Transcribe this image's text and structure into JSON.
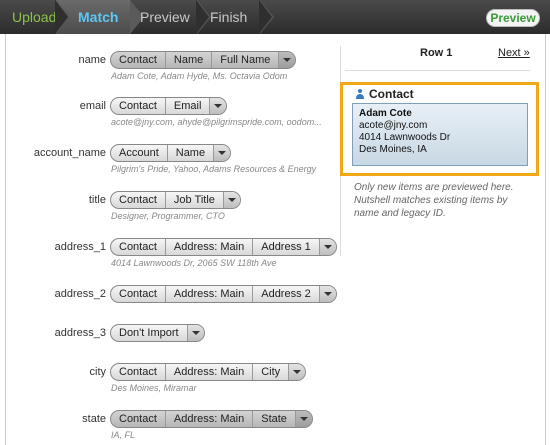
{
  "steps": {
    "upload": "Upload",
    "match": "Match",
    "preview": "Preview",
    "finish": "Finish",
    "preview_button": "Preview"
  },
  "fields": [
    {
      "name": "name",
      "pills": [
        "Contact",
        "Name",
        "Full Name"
      ],
      "dark": true,
      "sample": "Adam Cote, Adam Hyde, Ms. Octavia Odom"
    },
    {
      "name": "email",
      "pills": [
        "Contact",
        "Email"
      ],
      "dark": false,
      "sample": "acote@jny.com, ahyde@pilgrimspride.com, oodom..."
    },
    {
      "name": "account_name",
      "pills": [
        "Account",
        "Name"
      ],
      "dark": false,
      "sample": "Pilgrim's Pride, Yahoo, Adams Resources & Energy"
    },
    {
      "name": "title",
      "pills": [
        "Contact",
        "Job Title"
      ],
      "dark": false,
      "sample": "Designer, Programmer, CTO"
    },
    {
      "name": "address_1",
      "pills": [
        "Contact",
        "Address: Main",
        "Address 1"
      ],
      "dark": false,
      "sample": "4014 Lawnwoods Dr, 2065 SW 118th Ave"
    },
    {
      "name": "address_2",
      "pills": [
        "Contact",
        "Address: Main",
        "Address 2"
      ],
      "dark": false,
      "sample": ""
    },
    {
      "name": "address_3",
      "pills": [
        "Don't Import"
      ],
      "dark": false,
      "sample": ""
    },
    {
      "name": "city",
      "pills": [
        "Contact",
        "Address: Main",
        "City"
      ],
      "dark": false,
      "sample": "Des Moines, Miramar"
    },
    {
      "name": "state",
      "pills": [
        "Contact",
        "Address: Main",
        "State"
      ],
      "dark": true,
      "sample": "IA, FL"
    }
  ],
  "preview_panel": {
    "row_label": "Row 1",
    "next_link": "Next »",
    "entity_title": "Contact",
    "card_lines": [
      "Adam Cote",
      "acote@jny.com",
      "4014 Lawnwoods Dr",
      "Des Moines, IA"
    ],
    "note": "Only new items are previewed here. Nutshell matches existing items by name and legacy ID."
  },
  "colors": {
    "accent_orange": "#f0a818",
    "step_active": "#5bc8f5",
    "step_done": "#8bc34a"
  }
}
